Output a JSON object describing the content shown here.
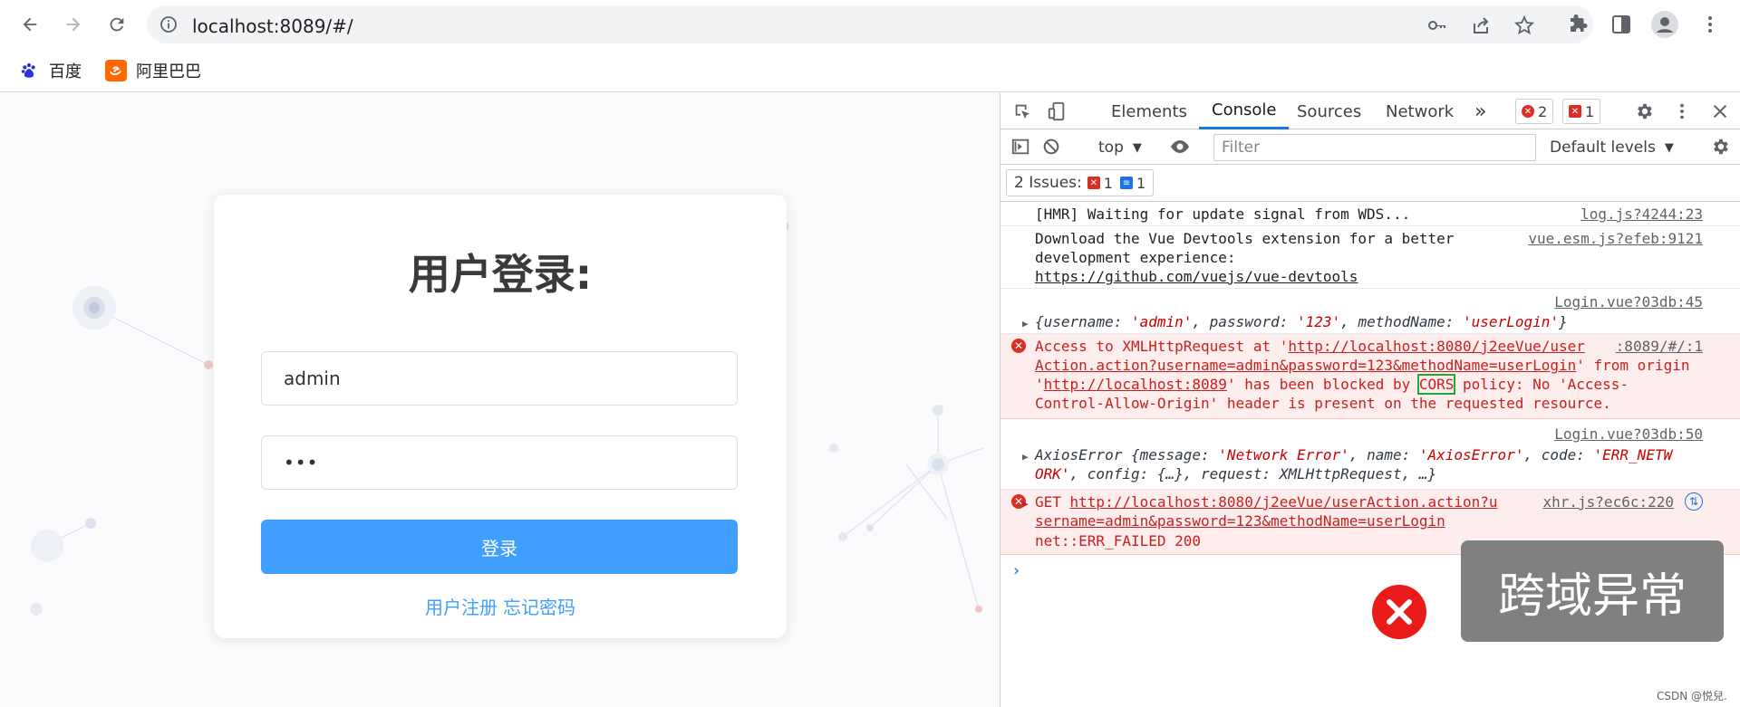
{
  "browser": {
    "url": "localhost:8089/#/",
    "bookmarks": [
      {
        "label": "百度",
        "icon": "baidu-paw-icon",
        "color": "#2932e1"
      },
      {
        "label": "阿里巴巴",
        "icon": "alibaba-icon",
        "color": "#ff6a00"
      }
    ]
  },
  "page": {
    "title": "用户登录:",
    "username_value": "admin",
    "password_value": "•••",
    "login_button": "登录",
    "register_link": "用户注册",
    "forgot_link": "忘记密码",
    "accent_color": "#409eff"
  },
  "devtools": {
    "tabs": [
      "Elements",
      "Console",
      "Sources",
      "Network"
    ],
    "active_tab": "Console",
    "more_tabs": "»",
    "error_count": "2",
    "issue_badge_count": "1",
    "context": "top",
    "filter_placeholder": "Filter",
    "levels": "Default levels",
    "issues_label": "2 Issues:",
    "issues_error": "1",
    "issues_info": "1",
    "messages": {
      "m1_text": "[HMR] Waiting for update signal from WDS...",
      "m1_src": "log.js?4244:23",
      "m2_line1": "Download the Vue Devtools extension for a better",
      "m2_line2": "development experience:",
      "m2_link": "https://github.com/vuejs/vue-devtools",
      "m2_src": "vue.esm.js?efeb:9121",
      "m3_src": "Login.vue?03db:45",
      "m3_obj": {
        "open": "{",
        "k1": "username: ",
        "v1": "'admin'",
        "k2": ", password: ",
        "v2": "'123'",
        "k3": ", methodName: ",
        "v3": "'userLogin'",
        "close": "}"
      },
      "m4_a": "Access to XMLHttpRequest at '",
      "m4_url1": "http://localhost:8080/j2eeVue/user",
      "m4_src": ":8089/#/:1",
      "m4_url2": "Action.action?username=admin&password=123&methodName=userLogin",
      "m4_b": "' from origin",
      "m4_c": "'",
      "m4_origin": "http://localhost:8089",
      "m4_d": "' has been blocked by ",
      "m4_cors": "CORS",
      "m4_e": " policy: No 'Access-",
      "m4_f": "Control-Allow-Origin' header is present on the requested resource.",
      "m5_src": "Login.vue?03db:50",
      "m5_line1_a": "AxiosError {",
      "m5_line1_b": "message: ",
      "m5_line1_c": "'Network Error'",
      "m5_line1_d": ", name: ",
      "m5_line1_e": "'AxiosError'",
      "m5_line1_f": ", code: ",
      "m5_line1_g": "'ERR_NETW",
      "m5_line2_a": "ORK'",
      "m5_line2_b": ", config: {…}, request: XMLHttpRequest, …}",
      "m6_get": "GET ",
      "m6_url1": "http://localhost:8080/j2eeVue/userAction.action?u",
      "m6_src": "xhr.js?ec6c:220",
      "m6_url2": "sername=admin&password=123&methodName=userLogin",
      "m6_status": "net::ERR_FAILED 200",
      "prompt": "›"
    }
  },
  "annotation": {
    "label": "跨域异常",
    "icon": "error-x-icon"
  },
  "watermark": "CSDN @悦兒."
}
